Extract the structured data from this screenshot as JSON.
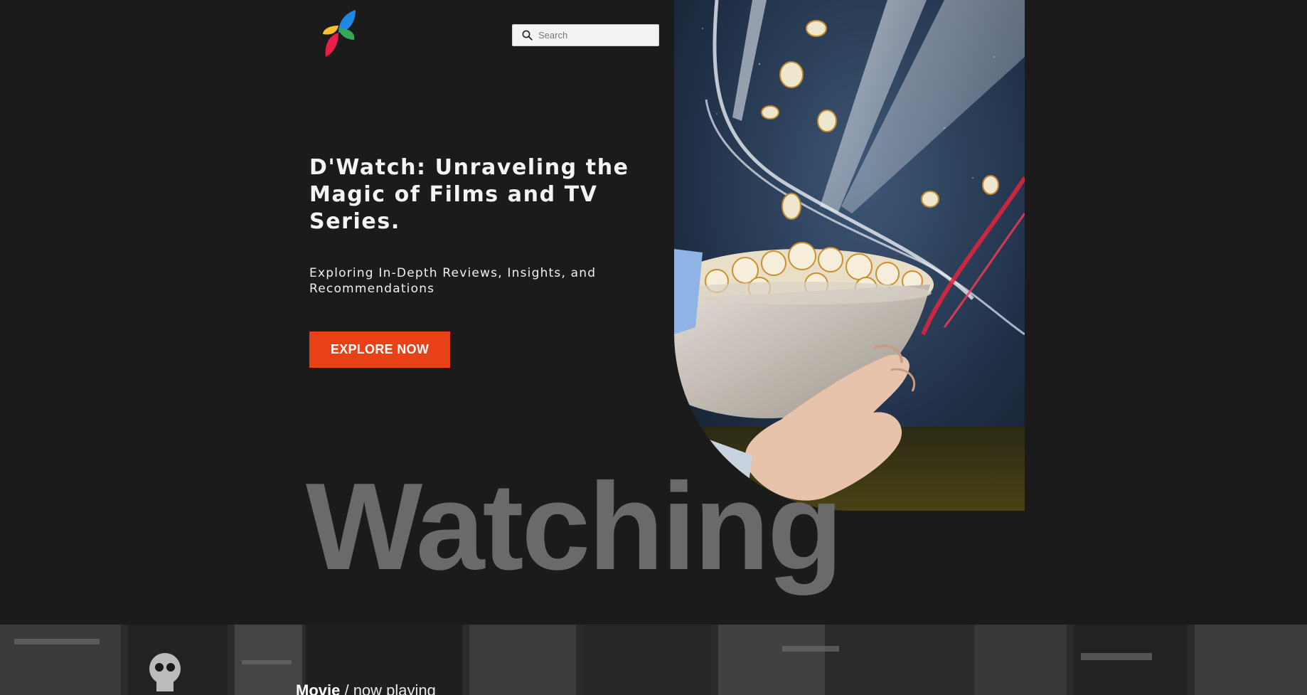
{
  "header": {
    "search": {
      "placeholder": "Search"
    }
  },
  "hero": {
    "title": "D'Watch: Unraveling the Magic of Films and TV Series.",
    "subtitle": "Exploring In-Depth Reviews, Insights, and Recommendations",
    "cta_label": "EXPLORE NOW",
    "big_word": "Watching"
  },
  "section": {
    "breadcrumb_main": "Movie",
    "breadcrumb_rest": " / now playing"
  },
  "colors": {
    "background": "#1b1b1b",
    "accent": "#e84118",
    "big_word": "#6a6a6a"
  },
  "icons": {
    "logo": "four-petal-color-logo",
    "search": "search-icon"
  }
}
